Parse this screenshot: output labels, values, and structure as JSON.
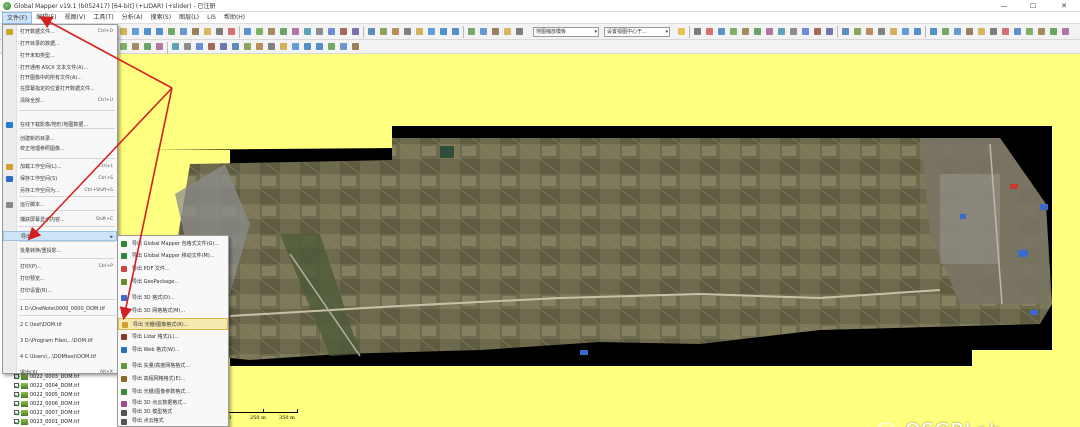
{
  "window": {
    "title": "Global Mapper v19.1 (b052417) [64-bit] (+LIDAR) (+slider) - 已注册",
    "minimize_glyph": "—",
    "maximize_glyph": "☐",
    "close_glyph": "✕"
  },
  "menubar": {
    "items": [
      "文件(F)",
      "编辑(E)",
      "视图(V)",
      "工具(T)",
      "分析(A)",
      "搜索(S)",
      "图层(L)",
      "LiS",
      "帮助(H)"
    ]
  },
  "toolbar": {
    "layer_select": "地图缩放模板",
    "projection_select": "设置视图中心于...",
    "dropdown_arrow": "▾"
  },
  "file_menu": {
    "items": [
      {
        "label": "打开数据文件...",
        "shortcut": "Ctrl+O"
      },
      {
        "label": "打开目录的数据...",
        "shortcut": ""
      },
      {
        "label": "打开未知类型...",
        "shortcut": ""
      },
      {
        "label": "打开通用 ASCII 文本文件(A)...",
        "shortcut": ""
      },
      {
        "label": "打开图像中的所有文件(A)...",
        "shortcut": ""
      },
      {
        "label": "在屏幕指定的位置打开数据文件...",
        "shortcut": ""
      },
      {
        "label": "清除全部...",
        "shortcut": "Ctrl+U"
      },
      {
        "label": "在线下载影像/地形/地图数据...",
        "shortcut": ""
      },
      {
        "label": "创建新的目录...",
        "shortcut": ""
      },
      {
        "label": "校正地理参照图像...",
        "shortcut": ""
      },
      {
        "label": "加载工作空间(L)...",
        "shortcut": "Ctrl+L"
      },
      {
        "label": "保存工作空间(S)",
        "shortcut": "Ctrl+S"
      },
      {
        "label": "另存工作空间为...",
        "shortcut": "Ctrl+Shift+S"
      },
      {
        "label": "运行脚本...",
        "shortcut": ""
      },
      {
        "label": "捕获屏幕显示内容...",
        "shortcut": "Shift+C"
      },
      {
        "label": "导出",
        "shortcut": ""
      },
      {
        "label": "批量转换/重投影...",
        "shortcut": ""
      },
      {
        "label": "打印(P)...",
        "shortcut": "Ctrl+P"
      },
      {
        "label": "打印预览...",
        "shortcut": ""
      },
      {
        "label": "打印设置(R)...",
        "shortcut": ""
      },
      {
        "label": "1 D:\\OneNote\\0000_0000_DOM.tif",
        "shortcut": ""
      },
      {
        "label": "2 C:\\test\\DOM.tif",
        "shortcut": ""
      },
      {
        "label": "3 D:\\Program Files\\...\\DOM.tif",
        "shortcut": ""
      },
      {
        "label": "4 C:\\Users\\...\\DOMtest\\DOM.tif",
        "shortcut": ""
      },
      {
        "label": "退出(X)",
        "shortcut": "Alt+X"
      }
    ]
  },
  "export_submenu": {
    "items": [
      "导出 Global Mapper 包格式文件(G)...",
      "导出 Global Mapper 移动文件(M)...",
      "导出 PDF 文件...",
      "导出 GeoPackage...",
      "导出 3D 格式(D)...",
      "导出 3D 网格格式(M)...",
      "导出 光栅/图像格式(R)...",
      "导出 Lidar 格式(L)...",
      "导出 Web 格式(W)...",
      "导出 矢量/高度网格格式...",
      "导出 高程网格格式(E)...",
      "导出 光栅/图像参数格式...",
      "导出 3D 点云数据格式...",
      "导出 3D 模型格式",
      "导出 点云格式"
    ]
  },
  "layers": {
    "items": [
      "0022_0003_DOM.tif",
      "0022_0004_DOM.tif",
      "0022_0005_DOM.tif",
      "0022_0006_DOM.tif",
      "0022_0007_DOM.tif",
      "0023_0001_DOM.tif"
    ]
  },
  "scale_bar": {
    "labels": [
      "0",
      "250 m",
      "350 m"
    ]
  },
  "watermark": {
    "text": "OSGBLab"
  },
  "colors": {
    "map_background": "#ffff80",
    "annotation_arrow": "#d62020",
    "menu_highlight": "#cde3f7",
    "submenu_highlight": "#f7e8b0"
  }
}
